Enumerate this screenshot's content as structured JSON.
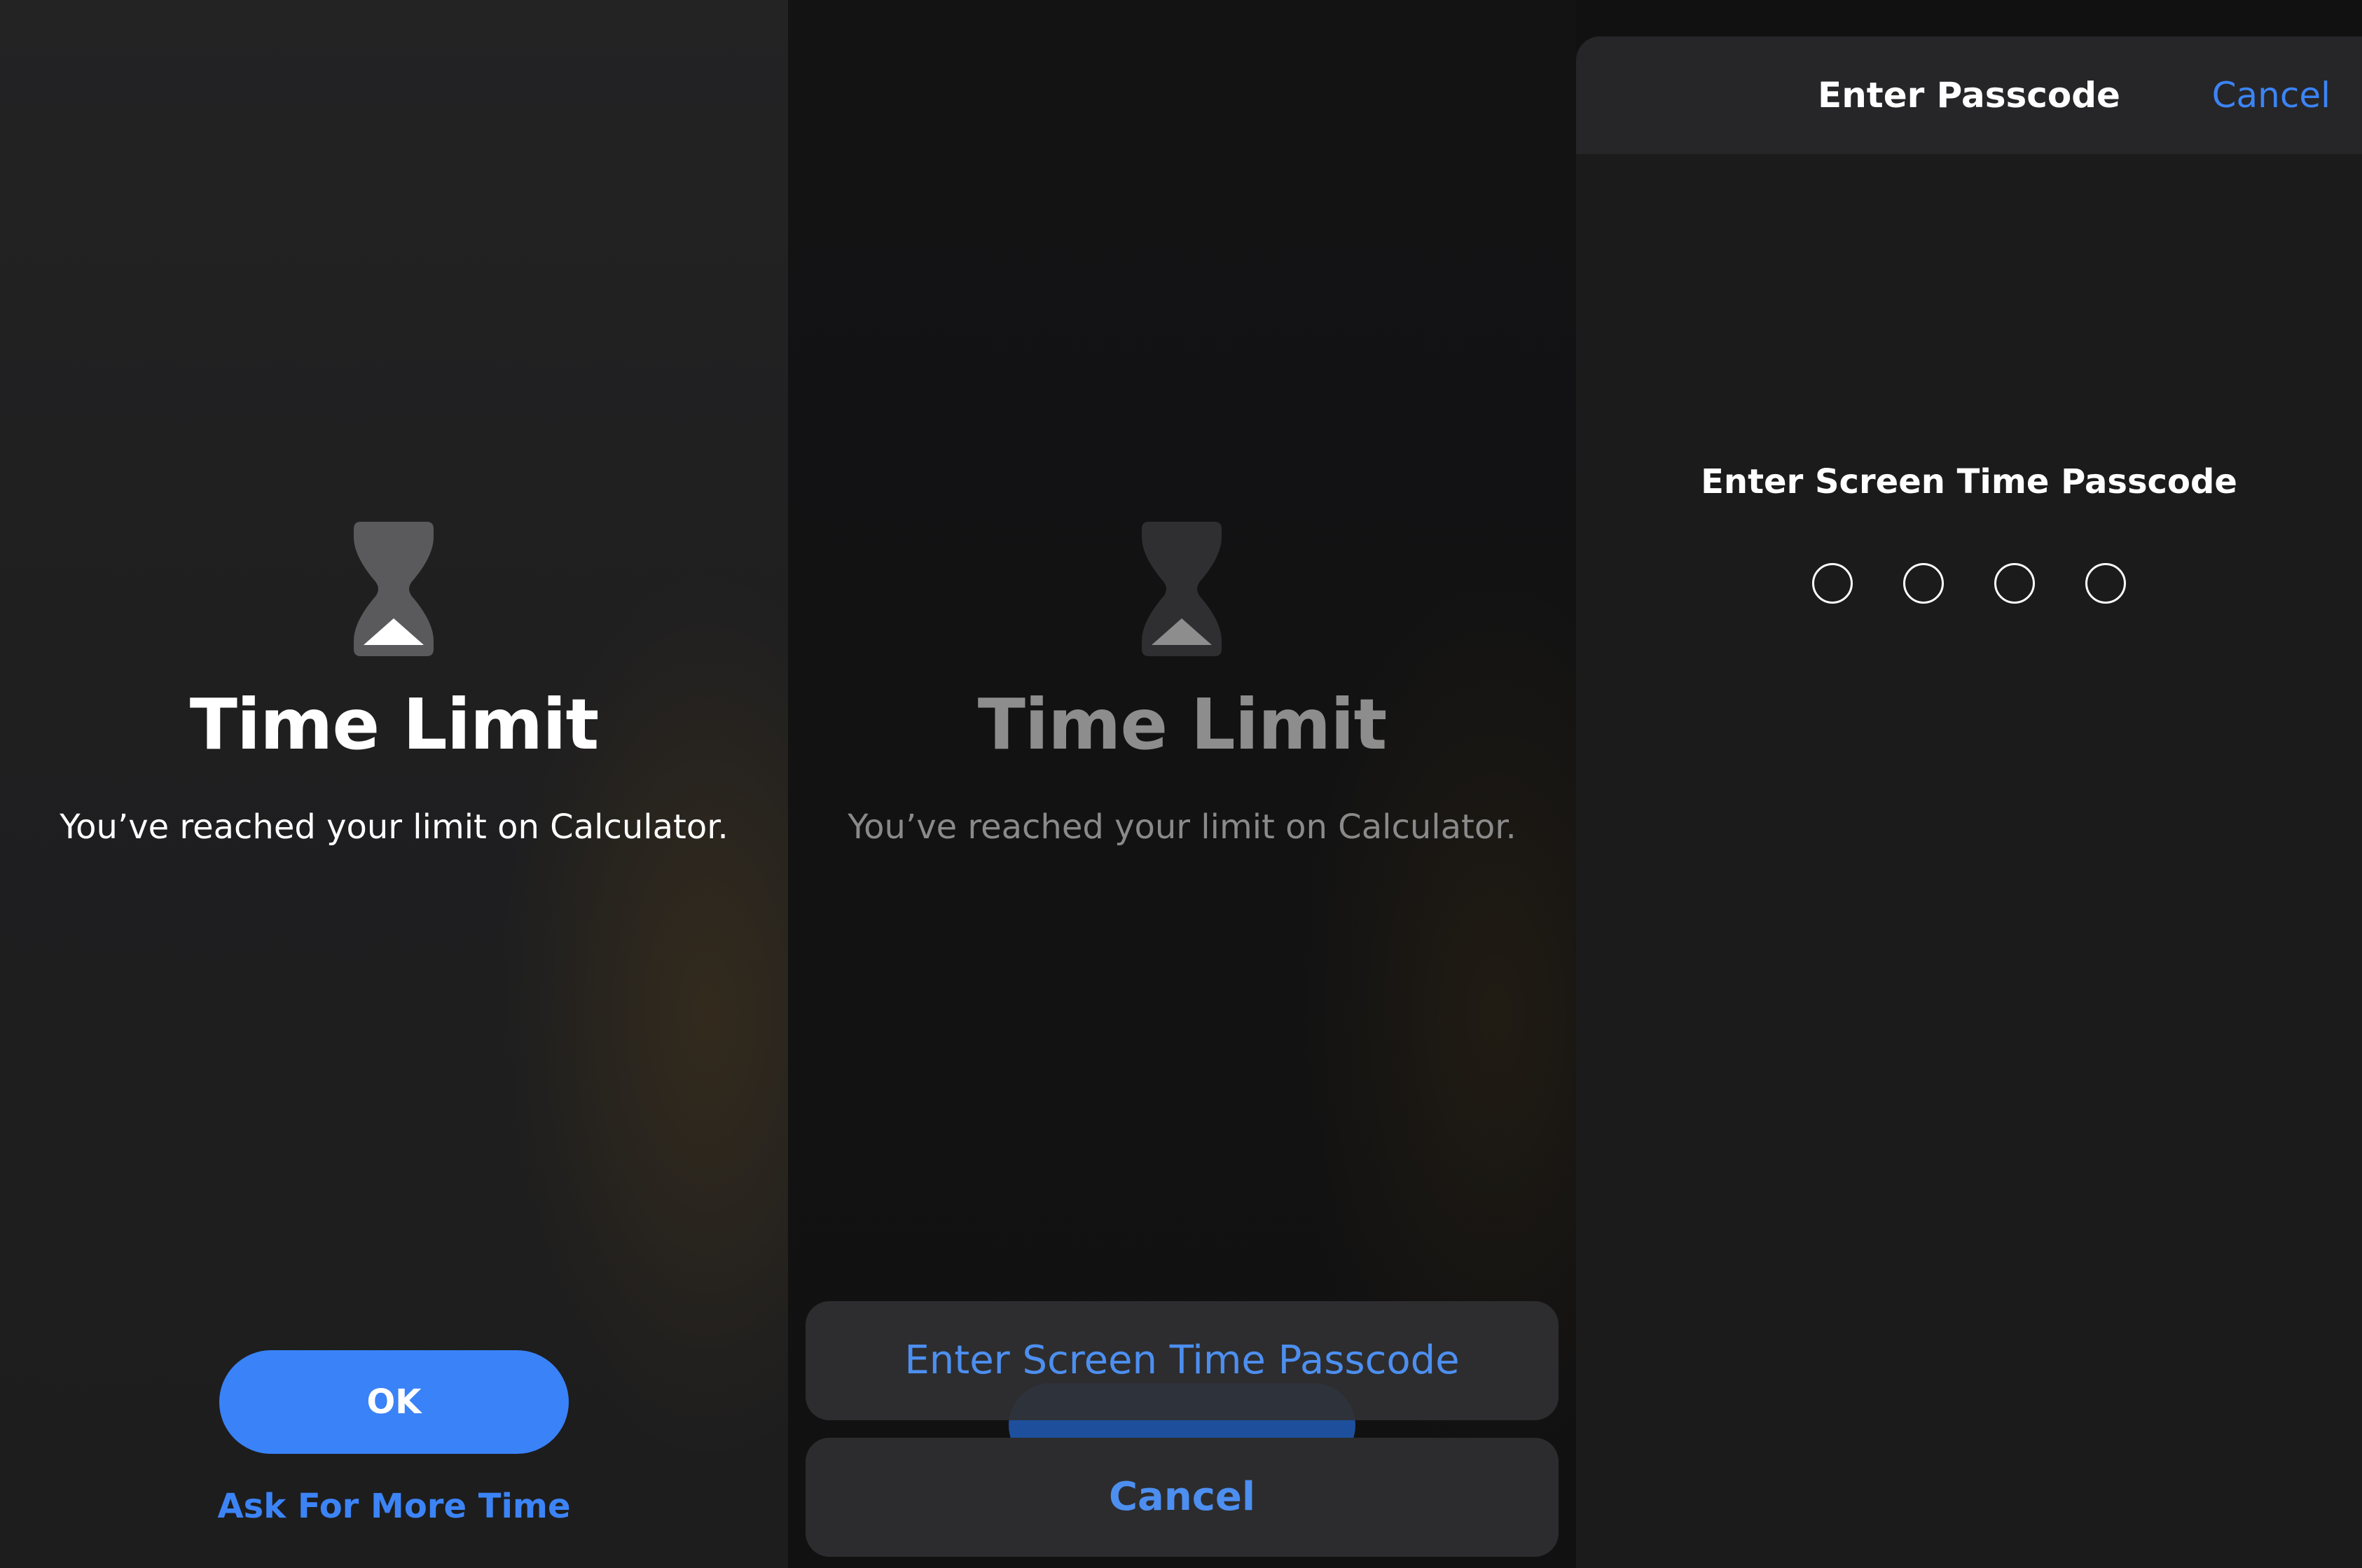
{
  "panels": [
    {
      "icon": "hourglass-icon",
      "title": "Time Limit",
      "message": "You’ve reached your limit on Calculator.",
      "ok_label": "OK",
      "ask_label": "Ask For More Time"
    },
    {
      "icon": "hourglass-icon",
      "title": "Time Limit",
      "message": "You’ve reached your limit on Calculator.",
      "action_sheet": {
        "passcode_label": "Enter Screen Time Passcode",
        "cancel_label": "Cancel"
      }
    },
    {
      "nav_title": "Enter Passcode",
      "nav_cancel": "Cancel",
      "prompt": "Enter Screen Time Passcode",
      "passcode_length": 4
    }
  ],
  "colors": {
    "accent": "#3a82f7",
    "link": "#3c84f6",
    "background": "#1f1f20"
  }
}
